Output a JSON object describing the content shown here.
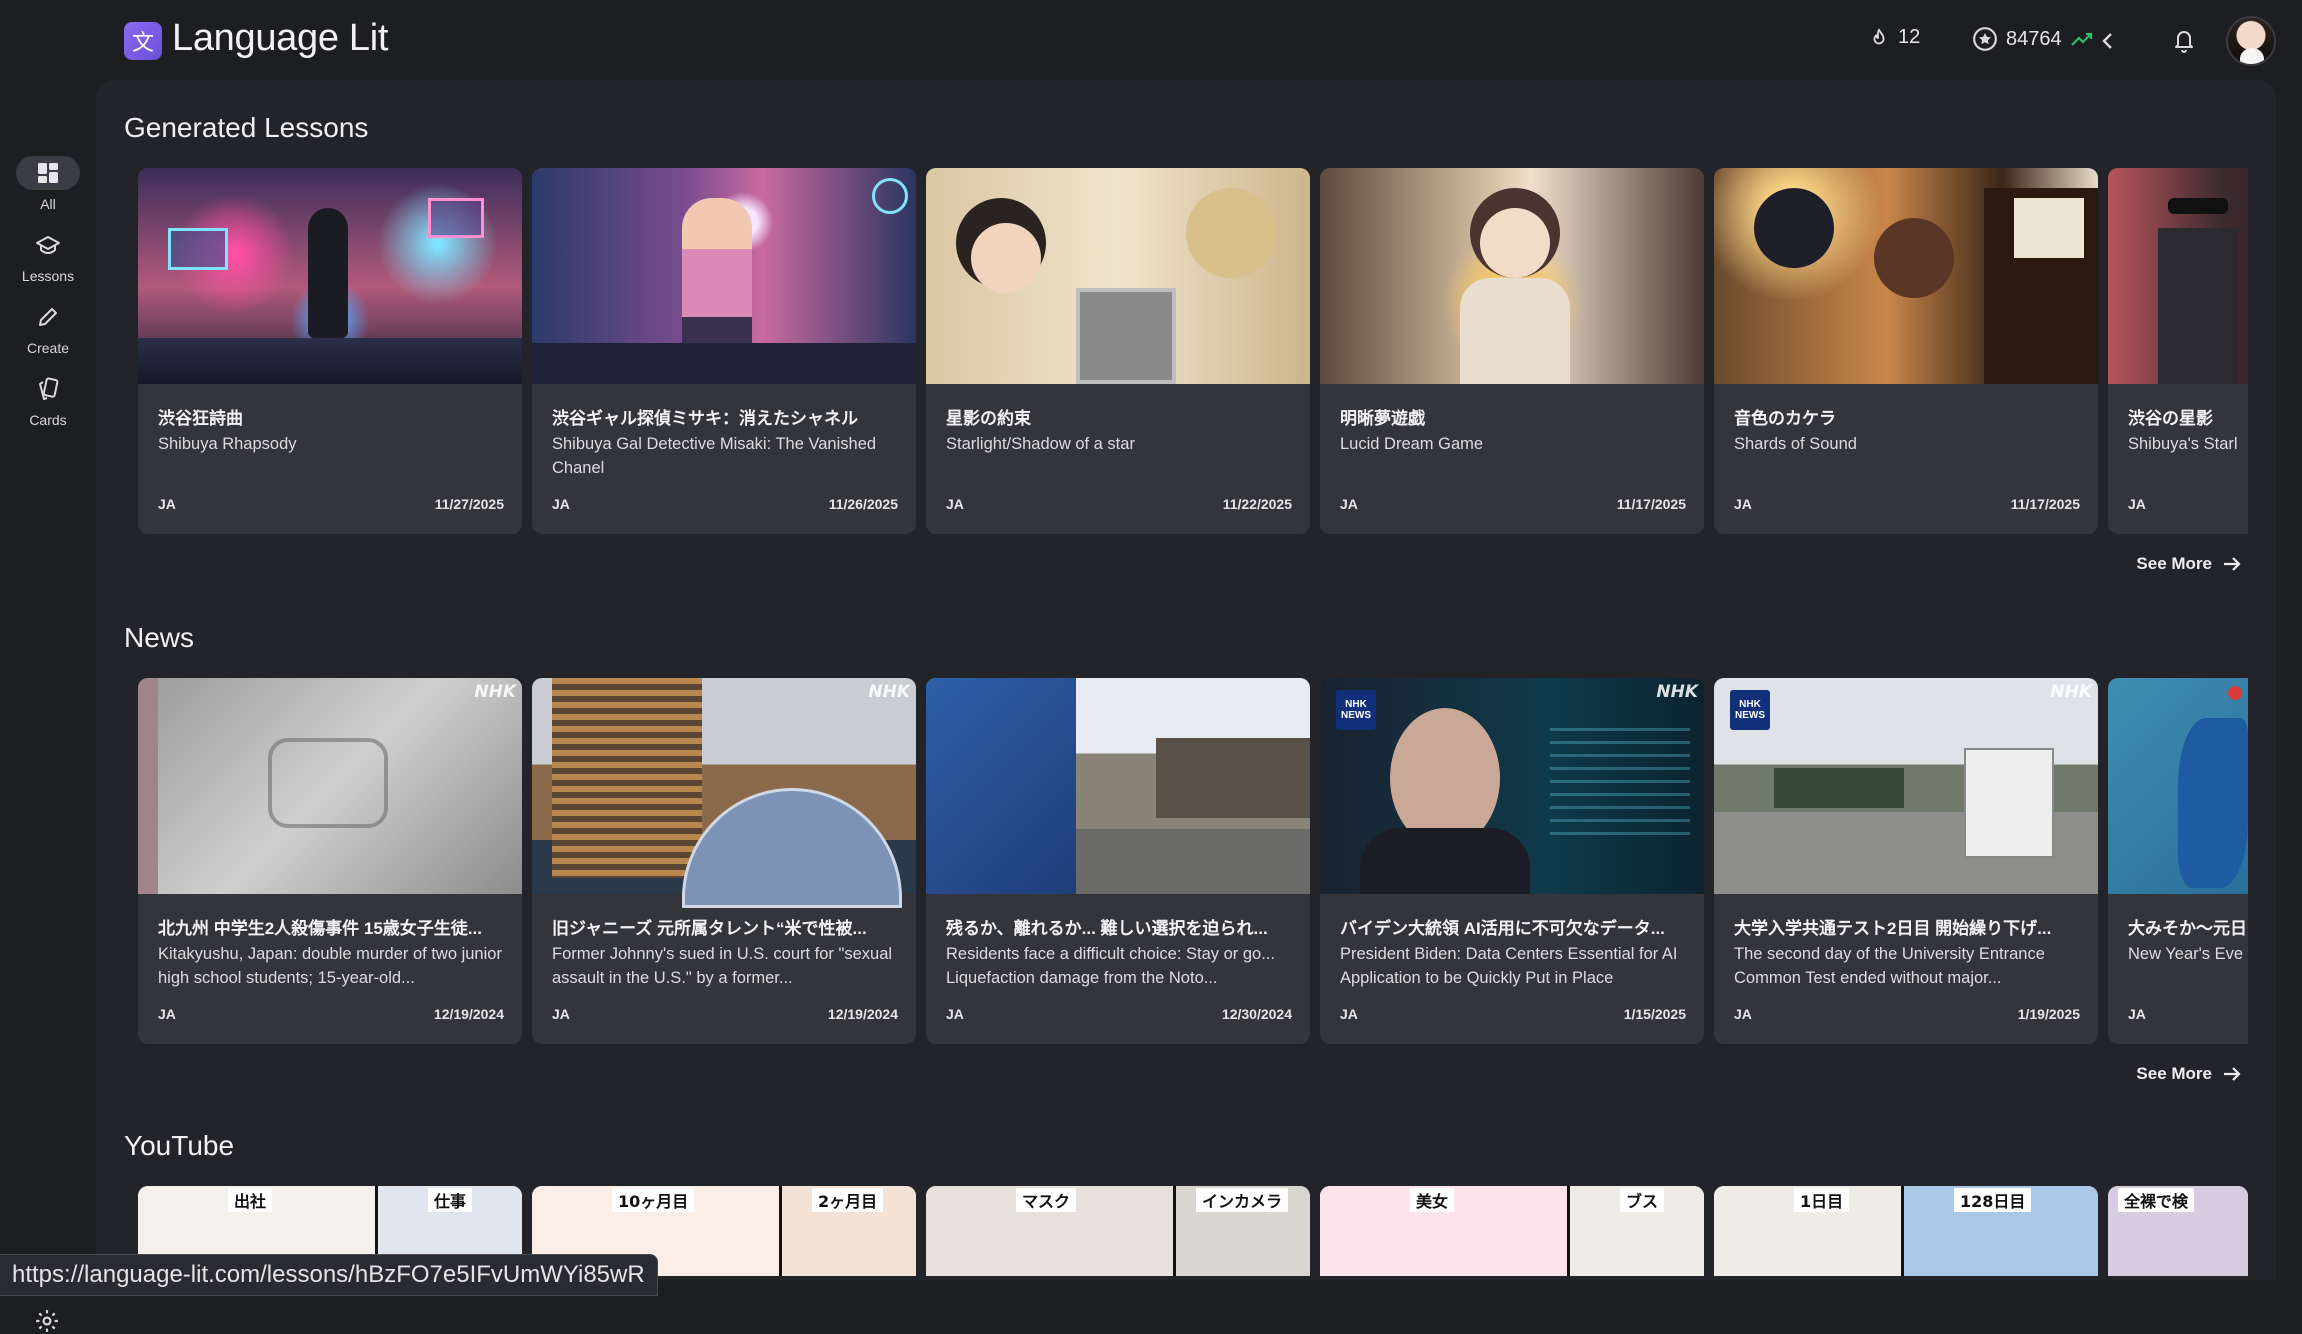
{
  "app": {
    "title": "Language Lit",
    "logo_glyph": "文"
  },
  "header": {
    "streak": "12",
    "points": "84764"
  },
  "sidebar": {
    "items": [
      {
        "label": "All"
      },
      {
        "label": "Lessons"
      },
      {
        "label": "Create"
      },
      {
        "label": "Cards"
      }
    ]
  },
  "sections": {
    "lessons": {
      "title": "Generated Lessons",
      "see_more": "See More",
      "cards": [
        {
          "title": "渋谷狂詩曲",
          "subtitle": "Shibuya Rhapsody",
          "lang": "JA",
          "date": "11/27/2025"
        },
        {
          "title": "渋谷ギャル探偵ミサキ：消えたシャネル",
          "subtitle": "Shibuya Gal Detective Misaki: The Vanished Chanel",
          "lang": "JA",
          "date": "11/26/2025"
        },
        {
          "title": "星影の約束",
          "subtitle": "Starlight/Shadow of a star",
          "lang": "JA",
          "date": "11/22/2025"
        },
        {
          "title": "明晰夢遊戯",
          "subtitle": "Lucid Dream Game",
          "lang": "JA",
          "date": "11/17/2025"
        },
        {
          "title": "音色のカケラ",
          "subtitle": "Shards of Sound",
          "lang": "JA",
          "date": "11/17/2025"
        },
        {
          "title": "渋谷の星影",
          "subtitle": "Shibuya's Starl",
          "lang": "JA",
          "date": ""
        }
      ]
    },
    "news": {
      "title": "News",
      "see_more": "See More",
      "cards": [
        {
          "title": "北九州 中学生2人殺傷事件 15歳女子生徒...",
          "subtitle": "Kitakyushu, Japan: double murder of two junior high school students; 15-year-old...",
          "lang": "JA",
          "date": "12/19/2024",
          "watermark": "NHK"
        },
        {
          "title": "旧ジャニーズ 元所属タレント“米で性被...",
          "subtitle": "Former Johnny's sued in U.S. court for \"sexual assault in the U.S.\" by a former...",
          "lang": "JA",
          "date": "12/19/2024",
          "watermark": "NHK"
        },
        {
          "title": "残るか、離れるか... 難しい選択を迫られ...",
          "subtitle": "Residents face a difficult choice: Stay or go... Liquefaction damage from the Noto...",
          "lang": "JA",
          "date": "12/30/2024",
          "watermark": ""
        },
        {
          "title": "バイデン大統領 AI活用に不可欠なデータ...",
          "subtitle": "President Biden: Data Centers Essential for AI Application to be Quickly Put in Place",
          "lang": "JA",
          "date": "1/15/2025",
          "watermark": "NHK",
          "badge_top": "NHK",
          "badge_bottom": "NEWS"
        },
        {
          "title": "大学入学共通テスト2日目 開始繰り下げ...",
          "subtitle": "The second day of the University Entrance Common Test ended without major...",
          "lang": "JA",
          "date": "1/19/2025",
          "watermark": "NHK",
          "badge_top": "NHK",
          "badge_bottom": "NEWS"
        },
        {
          "title": "大みそか〜元日",
          "subtitle": "New Year's Eve snow in northe",
          "lang": "JA",
          "date": "",
          "watermark": ""
        }
      ]
    },
    "youtube": {
      "title": "YouTube",
      "tags": [
        [
          "出社",
          "仕事"
        ],
        [
          "10ヶ月目",
          "2ヶ月目"
        ],
        [
          "マスク",
          "インカメラ"
        ],
        [
          "美女",
          "ブス"
        ],
        [
          "1日目",
          "128日目"
        ],
        [
          "全裸で検",
          ""
        ]
      ]
    }
  },
  "status_url": "https://language-lit.com/lessons/hBzFO7e5IFvUmWYi85wR"
}
